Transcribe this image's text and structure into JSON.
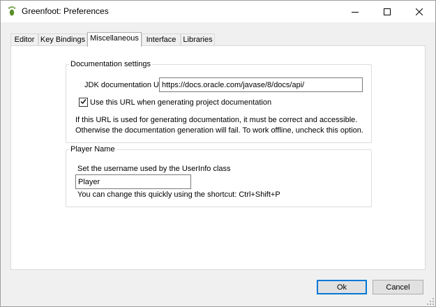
{
  "window": {
    "title": "Greenfoot: Preferences"
  },
  "tabs": [
    {
      "label": "Editor"
    },
    {
      "label": "Key Bindings"
    },
    {
      "label": "Miscellaneous"
    },
    {
      "label": "Interface"
    },
    {
      "label": "Libraries"
    }
  ],
  "documentation": {
    "group_title": "Documentation settings",
    "url_label": "JDK documentation URL",
    "url_value": "https://docs.oracle.com/javase/8/docs/api/",
    "use_url_checked": true,
    "use_url_label": "Use this URL when generating project documentation",
    "help_line1": "If this URL is used for generating documentation, it must be correct and accessible.",
    "help_line2": "Otherwise the documentation generation will fail. To work offline, uncheck this option."
  },
  "player": {
    "group_title": "Player Name",
    "username_label": "Set the username used by the UserInfo class",
    "username_value": "Player",
    "shortcut_hint": "You can change this quickly using the shortcut: Ctrl+Shift+P"
  },
  "buttons": {
    "ok": "Ok",
    "cancel": "Cancel"
  }
}
